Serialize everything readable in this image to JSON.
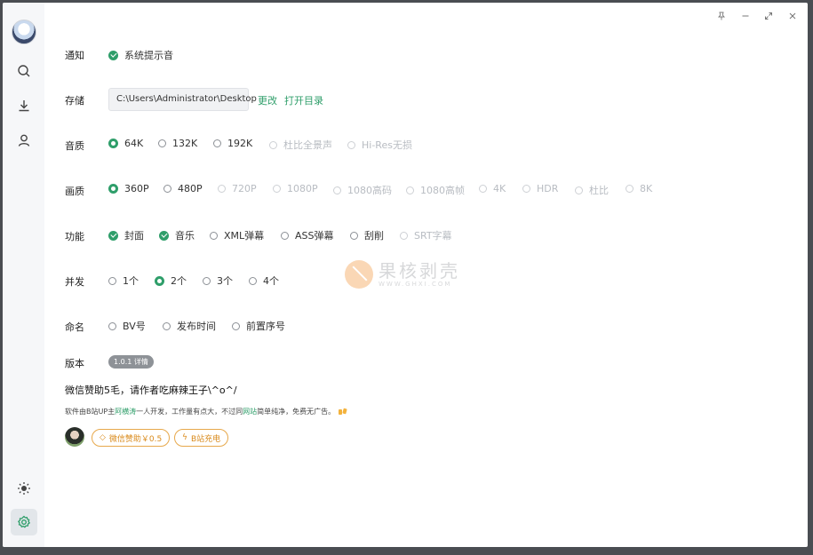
{
  "window_controls": {
    "pin": "📌",
    "minimize": "—",
    "restore": "⤢",
    "close": "✕"
  },
  "sidebar": {
    "items": [
      {
        "name": "search"
      },
      {
        "name": "download"
      },
      {
        "name": "user"
      },
      {
        "name": "theme"
      },
      {
        "name": "settings",
        "active": true
      }
    ]
  },
  "notify": {
    "label": "通知",
    "option": "系统提示音"
  },
  "storage": {
    "label": "存储",
    "path": "C:\\Users\\Administrator\\Desktop",
    "change": "更改",
    "open_dir": "打开目录"
  },
  "audio": {
    "label": "音质",
    "options": [
      "64K",
      "132K",
      "192K",
      "杜比全景声",
      "Hi-Res无损"
    ],
    "selected": "64K"
  },
  "video": {
    "label": "画质",
    "options": [
      "360P",
      "480P",
      "720P",
      "1080P",
      "1080高码",
      "1080高帧",
      "4K",
      "HDR",
      "杜比",
      "8K"
    ],
    "selected": "360P"
  },
  "features": {
    "label": "功能",
    "options": [
      "封面",
      "音乐",
      "XML弹幕",
      "ASS弹幕",
      "刮削",
      "SRT字幕"
    ],
    "checked": [
      "封面",
      "音乐"
    ]
  },
  "concurrency": {
    "label": "并发",
    "options": [
      "1个",
      "2个",
      "3个",
      "4个"
    ],
    "selected": "2个"
  },
  "naming": {
    "label": "命名",
    "options": [
      "BV号",
      "发布时间",
      "前置序号"
    ]
  },
  "version": {
    "label": "版本",
    "badge": "1.0.1 详情"
  },
  "donate": {
    "title": "微信赞助5毛，请作者吃麻辣王子\\^o^/",
    "desc_1": "软件由B站UP主",
    "author": "阿横涛",
    "desc_2": "一人开发，工作量有点大，不过同",
    "site": "网站",
    "desc_3": "简单纯净，免费无广告。",
    "wechat_button": "微信赞助￥0.5",
    "bili_button": "B站充电"
  },
  "watermark": {
    "cn": "果核剥壳",
    "en": "WWW.GHXI.COM"
  },
  "colors": {
    "accent": "#2f9e6a",
    "sidebar_bg": "#f6f7f9",
    "pill": "#e7a84b",
    "frame": "#4a4d52"
  }
}
